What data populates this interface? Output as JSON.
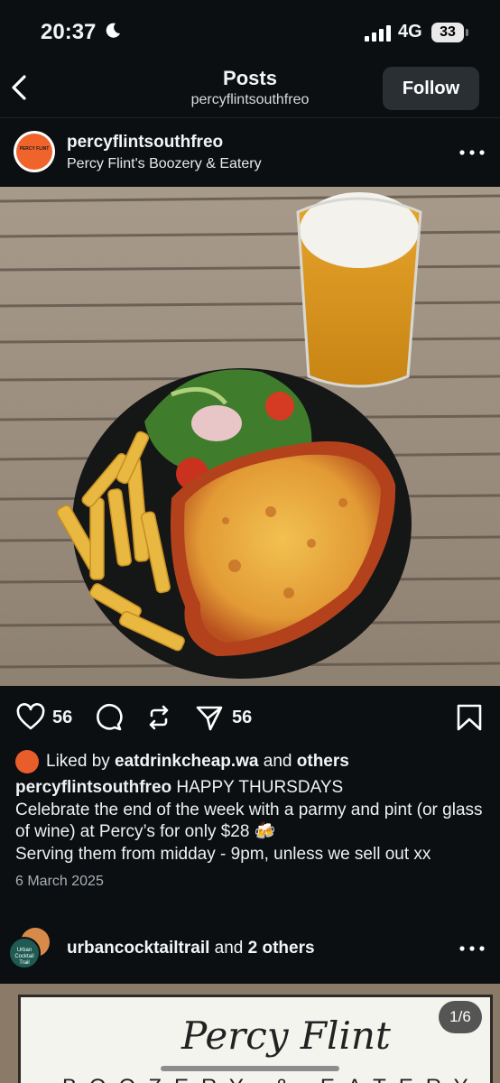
{
  "status_bar": {
    "time": "20:37",
    "network": "4G",
    "battery": "33"
  },
  "header": {
    "title": "Posts",
    "subtitle": "percyflintsouthfreo",
    "follow_label": "Follow"
  },
  "post": {
    "username": "percyflintsouthfreo",
    "location": "Percy Flint's Boozery & Eatery",
    "avatar_text": "PERCY FLINT",
    "likes_count": "56",
    "shares_count": "56",
    "liked_by_prefix": "Liked by ",
    "liked_by_user": "eatdrinkcheap.wa",
    "liked_by_middle": " and ",
    "liked_by_suffix": "others",
    "caption_user": "percyflintsouthfreo",
    "caption_title": " HAPPY THURSDAYS",
    "caption_line1": "Celebrate the end of the week with a parmy and pint (or glass of wine) at Percy’s for only $28 🍻",
    "caption_line2": "Serving them from midday - 9pm, unless we sell out xx",
    "date": "6 March 2025"
  },
  "next_post": {
    "username": "urbancocktailtrail",
    "middle": " and ",
    "others": "2 others",
    "avatar_text": "Urban Cocktail Trail",
    "image_counter": "1/6",
    "sign_script": "Percy Flint",
    "sign_sub": "BOOZERY & EATERY"
  },
  "colors": {
    "background": "#0b0f12",
    "follow_button": "#2a2f34",
    "avatar_accent": "#f0632b"
  }
}
